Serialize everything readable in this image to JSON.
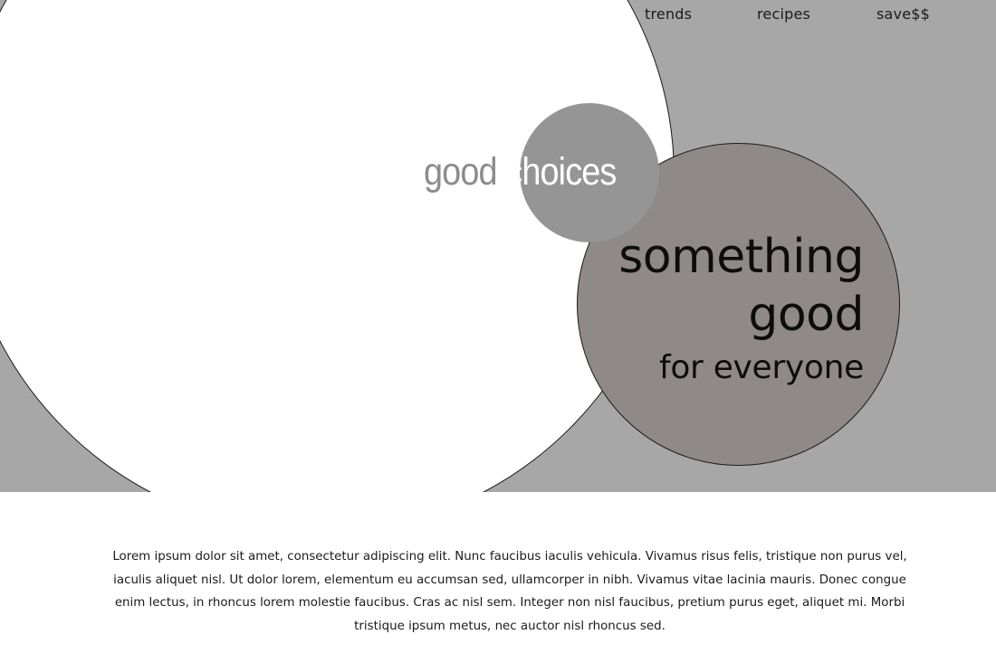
{
  "nav": {
    "items": [
      {
        "label": "trends"
      },
      {
        "label": "recipes"
      },
      {
        "label": "save$$"
      }
    ]
  },
  "hero": {
    "tagline_word1": "good",
    "tagline_word2": "choices",
    "headline_line1": "something",
    "headline_line2": "good",
    "headline_line3": "for everyone"
  },
  "body": {
    "text": "Lorem ipsum dolor sit amet, consectetur adipiscing elit. Nunc faucibus iaculis vehicula. Vivamus risus felis, tristique non purus vel, iaculis aliquet nisl. Ut dolor lorem, elementum eu accumsan sed, ullamcorper in nibh. Vivamus vitae lacinia mauris. Donec congue enim lectus, in rhoncus lorem molestie faucibus. Cras ac nisl sem. Integer non nisl faucibus, pretium purus eget, aliquet mi. Morbi tristique ipsum metus, nec auctor nisl rhoncus sed."
  },
  "colors": {
    "hero_background": "#a7a7a7",
    "big_circle": "#ffffff",
    "small_circle": "#959595",
    "medium_circle": "#8f8a87",
    "text_dark": "#0d0d0d"
  }
}
